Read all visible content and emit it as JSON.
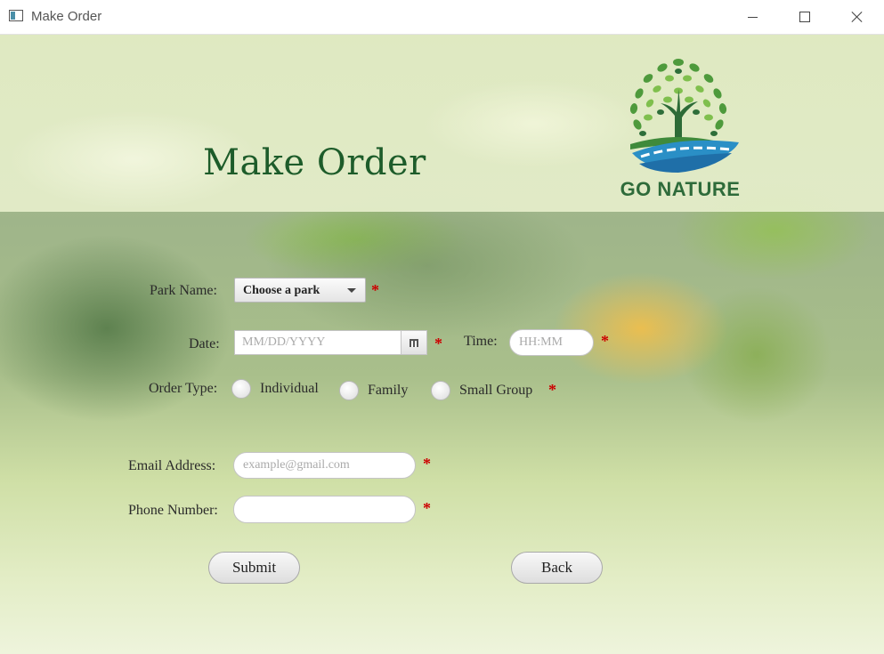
{
  "window": {
    "title": "Make Order"
  },
  "header": {
    "title": "Make Order",
    "logo_text": "GO NATURE"
  },
  "form": {
    "park": {
      "label": "Park Name:",
      "selected": "Choose a park"
    },
    "date": {
      "label": "Date:",
      "placeholder": "MM/DD/YYYY"
    },
    "time": {
      "label": "Time:",
      "placeholder": "HH:MM"
    },
    "order_type": {
      "label": "Order Type:",
      "options": [
        "Individual",
        "Family",
        "Small Group"
      ]
    },
    "email": {
      "label": "Email Address:",
      "placeholder": "example@gmail.com"
    },
    "phone": {
      "label": "Phone Number:",
      "value": ""
    },
    "required_mark": "*"
  },
  "buttons": {
    "submit": "Submit",
    "back": "Back"
  },
  "colors": {
    "title_green": "#1d5c2a",
    "required_red": "#cc0000"
  }
}
